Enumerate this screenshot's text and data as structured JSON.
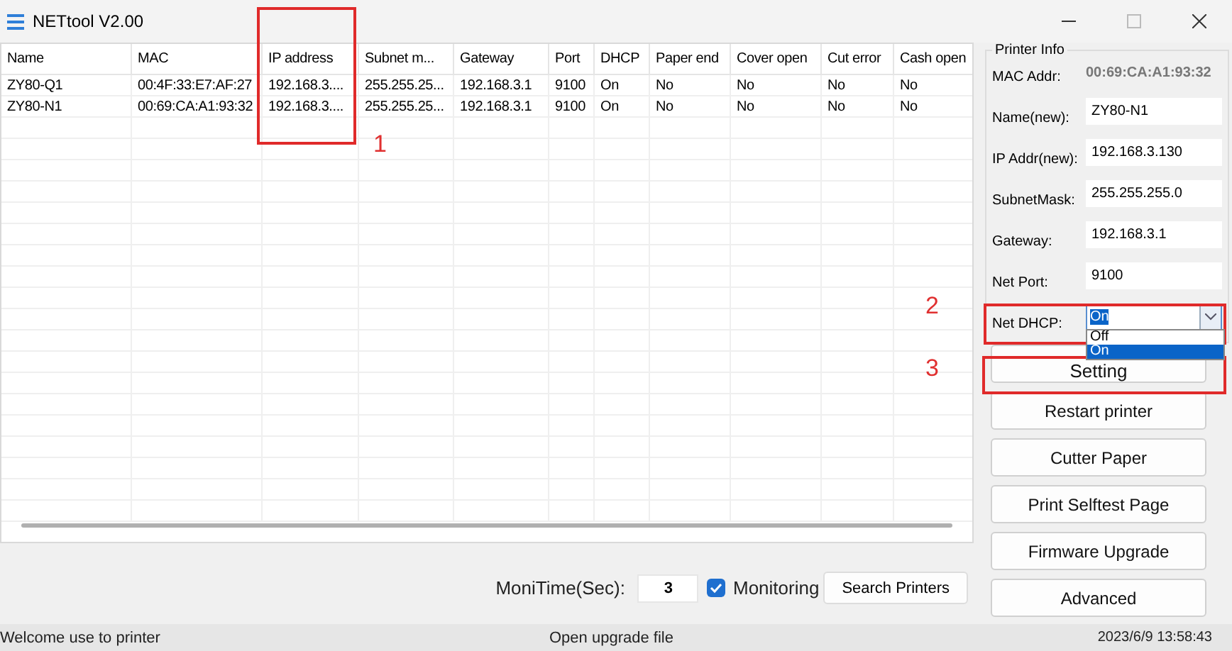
{
  "window": {
    "title": "NETtool V2.00"
  },
  "table": {
    "columns": [
      "Name",
      "MAC",
      "IP address",
      "Subnet m...",
      "Gateway",
      "Port",
      "DHCP",
      "Paper end",
      "Cover open",
      "Cut error",
      "Cash open"
    ],
    "rows": [
      [
        "ZY80-Q1",
        "00:4F:33:E7:AF:27",
        "192.168.3....",
        "255.255.25...",
        "192.168.3.1",
        "9100",
        "On",
        "No",
        "No",
        "No",
        "No"
      ],
      [
        "ZY80-N1",
        "00:69:CA:A1:93:32",
        "192.168.3....",
        "255.255.25...",
        "192.168.3.1",
        "9100",
        "On",
        "No",
        "No",
        "No",
        "No"
      ]
    ]
  },
  "printer_info": {
    "title": "Printer Info",
    "fields": [
      {
        "label": "MAC Addr:",
        "value": "00:69:CA:A1:93:32",
        "kind": "readonly"
      },
      {
        "label": "Name(new):",
        "value": "ZY80-N1",
        "kind": "text"
      },
      {
        "label": "IP Addr(new):",
        "value": "192.168.3.130",
        "kind": "text"
      },
      {
        "label": "SubnetMask:",
        "value": "255.255.255.0",
        "kind": "text"
      },
      {
        "label": "Gateway:",
        "value": "192.168.3.1",
        "kind": "text"
      },
      {
        "label": "Net Port:",
        "value": "9100",
        "kind": "text"
      },
      {
        "label": "Net DHCP:",
        "value": "On",
        "kind": "dropdown",
        "expanded": true,
        "options": [
          {
            "label": "Off",
            "selected": false
          },
          {
            "label": "On",
            "selected": true
          }
        ]
      }
    ]
  },
  "buttons": [
    "Setting",
    "Restart printer",
    "Cutter Paper",
    "Print Selftest Page",
    "Firmware Upgrade",
    "Advanced"
  ],
  "monitor": {
    "label": "MoniTime(Sec):",
    "value": "3",
    "monitoring": {
      "label": "Monitoring",
      "checked": true
    },
    "search_button": "Search Printers"
  },
  "status_bar": {
    "message": "Welcome use to printer",
    "action": "Open upgrade file",
    "time": "2023/6/9 13:58:43"
  },
  "annotations": [
    {
      "label": "1"
    },
    {
      "label": "2"
    },
    {
      "label": "3"
    }
  ]
}
